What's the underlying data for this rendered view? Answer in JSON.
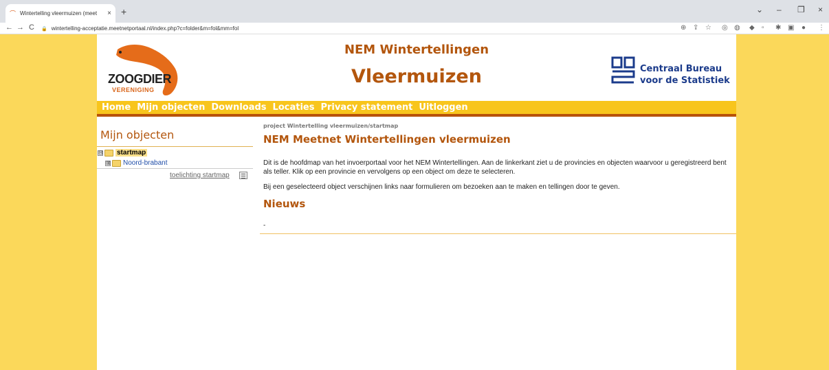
{
  "browser": {
    "tab_title": "Wintertelling vleermuizen (meet",
    "tab_close": "×",
    "new_tab": "+",
    "url": "wintertelling-acceptatie.meetnetportaal.nl/index.php?c=folder&m=fol&mm=fol",
    "back": "←",
    "forward": "→",
    "reload": "C",
    "minimize": "–",
    "restore": "❐",
    "close": "×",
    "chevron": "⌄"
  },
  "header": {
    "logo_line1": "ZOOGDIER",
    "logo_line2": "VERENIGING",
    "title": "NEM Wintertellingen",
    "subtitle": "Vleermuizen",
    "partner_line1": "Centraal Bureau",
    "partner_line2": "voor de Statistiek"
  },
  "menu": {
    "items": [
      "Home",
      "Mijn objecten",
      "Downloads",
      "Locaties",
      "Privacy statement",
      "Uitloggen"
    ]
  },
  "sidebar": {
    "title": "Mijn objecten",
    "tree": [
      {
        "label": "startmap",
        "expander": "⊟"
      },
      {
        "label": "Noord-brabant",
        "expander": "⊞"
      }
    ],
    "help_link": "toelichting startmap"
  },
  "main": {
    "breadcrumb": "project Wintertelling vleermuizen/startmap",
    "title": "NEM Meetnet Wintertellingen vleermuizen",
    "para1": "Dit is de hoofdmap van het invoerportaal voor het NEM Wintertellingen. Aan de linkerkant ziet u de provincies en objecten waarvoor u geregistreerd bent als teller. Klik op een provincie en vervolgens op een object om deze te selecteren.",
    "para2": "Bij een geselecteerd object verschijnen links naar formulieren om bezoeken aan te maken en tellingen door te geven.",
    "news_title": "Nieuws",
    "news_item": "-"
  },
  "colors": {
    "page_bg": "#fbd85a",
    "menu_bg": "#f8c51c",
    "accent": "#b3560d",
    "cbs_blue": "#1b3b8b"
  }
}
